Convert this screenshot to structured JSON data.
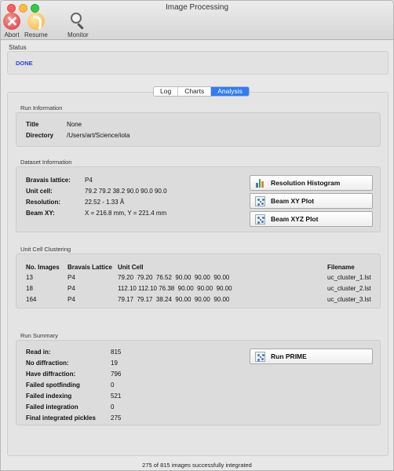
{
  "window": {
    "title": "Image Processing"
  },
  "toolbar": {
    "abort_label": "Abort",
    "resume_label": "Resume",
    "monitor_label": "Monitor"
  },
  "status": {
    "label": "Status",
    "value": "DONE",
    "value_color": "#2a43d8"
  },
  "tabs": [
    {
      "label": "Log",
      "active": false
    },
    {
      "label": "Charts",
      "active": false
    },
    {
      "label": "Analysis",
      "active": true
    }
  ],
  "accent_color": "#2f7cf6",
  "run_info": {
    "label": "Run Information",
    "title_label": "Title",
    "title_value": "None",
    "directory_label": "Directory",
    "directory_value": "/Users/art/Science/iota"
  },
  "dataset_info": {
    "label": "Dataset Information",
    "bravais_label": "Bravais lattice:",
    "bravais_value": "P4",
    "unit_cell_label": "Unit cell:",
    "unit_cell_value": "79.2 79.2 38.2 90.0 90.0 90.0",
    "resolution_label": "Resolution:",
    "resolution_value": "22.52 - 1.33 Å",
    "beam_xy_label": "Beam XY:",
    "beam_xy_value": "X = 216.8 mm, Y = 221.4 mm",
    "buttons": {
      "resolution_histogram": "Resolution Histogram",
      "beam_xy_plot": "Beam XY Plot",
      "beam_xyz_plot": "Beam XYZ Plot"
    }
  },
  "clustering": {
    "label": "Unit Cell Clustering",
    "headers": {
      "no_images": "No. Images",
      "bravais": "Bravais Lattice",
      "unit_cell": "Unit Cell",
      "filename": "Filename"
    },
    "rows": [
      {
        "no_images": "13",
        "bravais": "P4",
        "unit_cell": "79.20  79.20  76.52  90.00  90.00  90.00",
        "filename": "uc_cluster_1.lst"
      },
      {
        "no_images": "18",
        "bravais": "P4",
        "unit_cell": "112.10 112.10 76.38  90.00  90.00  90.00",
        "filename": "uc_cluster_2.lst"
      },
      {
        "no_images": "164",
        "bravais": "P4",
        "unit_cell": "79.17  79.17  38.24  90.00  90.00  90.00",
        "filename": "uc_cluster_3.lst"
      }
    ]
  },
  "run_summary": {
    "label": "Run Summary",
    "items": [
      {
        "label": "Read in:",
        "value": "815"
      },
      {
        "label": "No diffraction:",
        "value": "19"
      },
      {
        "label": "Have diffraction:",
        "value": "796"
      },
      {
        "label": "Failed spotfinding",
        "value": "0"
      },
      {
        "label": "Failed indexing",
        "value": "521"
      },
      {
        "label": "Failed integration",
        "value": "0"
      },
      {
        "label": "Final integrated pickles",
        "value": "275"
      }
    ],
    "run_prime_label": "Run PRIME"
  },
  "footer": {
    "text": "275 of 815 images successfully integrated"
  }
}
